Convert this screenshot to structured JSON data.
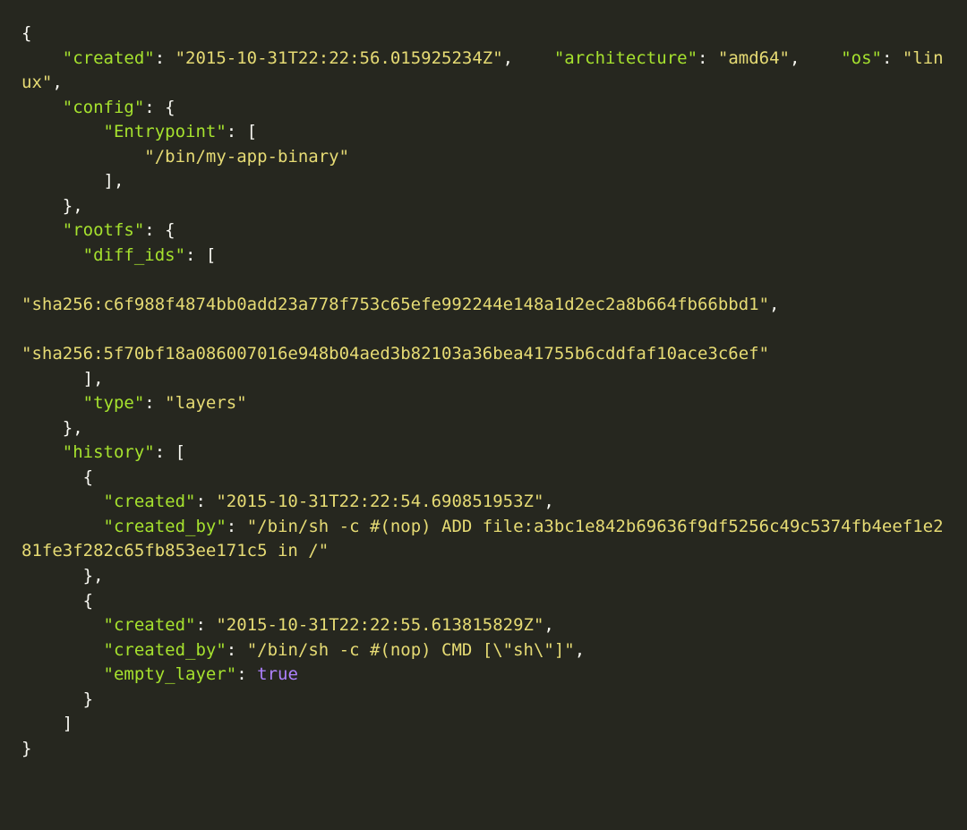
{
  "code": {
    "created_key": "\"created\"",
    "created_val": "\"2015-10-31T22:22:56.015925234Z\"",
    "architecture_key": "\"architecture\"",
    "architecture_val": "\"amd64\"",
    "os_key": "\"os\"",
    "os_val": "\"linux\"",
    "config_key": "\"config\"",
    "entrypoint_key": "\"Entrypoint\"",
    "entrypoint_val": "\"/bin/my-app-binary\"",
    "rootfs_key": "\"rootfs\"",
    "diff_ids_key": "\"diff_ids\"",
    "diff_id_1": "\"sha256:c6f988f4874bb0add23a778f753c65efe992244e148a1d2ec2a8b664fb66bbd1\"",
    "diff_id_2": "\"sha256:5f70bf18a086007016e948b04aed3b82103a36bea41755b6cddfaf10ace3c6ef\"",
    "type_key": "\"type\"",
    "type_val": "\"layers\"",
    "history_key": "\"history\"",
    "h0_created_key": "\"created\"",
    "h0_created_val": "\"2015-10-31T22:22:54.690851953Z\"",
    "h0_created_by_key": "\"created_by\"",
    "h0_created_by_val": "\"/bin/sh -c #(nop) ADD file:a3bc1e842b69636f9df5256c49c5374fb4eef1e281fe3f282c65fb853ee171c5 in /\"",
    "h1_created_key": "\"created\"",
    "h1_created_val": "\"2015-10-31T22:22:55.613815829Z\"",
    "h1_created_by_key": "\"created_by\"",
    "h1_created_by_val": "\"/bin/sh -c #(nop) CMD [\\\"sh\\\"]\"",
    "h1_empty_layer_key": "\"empty_layer\"",
    "h1_empty_layer_val": "true"
  }
}
